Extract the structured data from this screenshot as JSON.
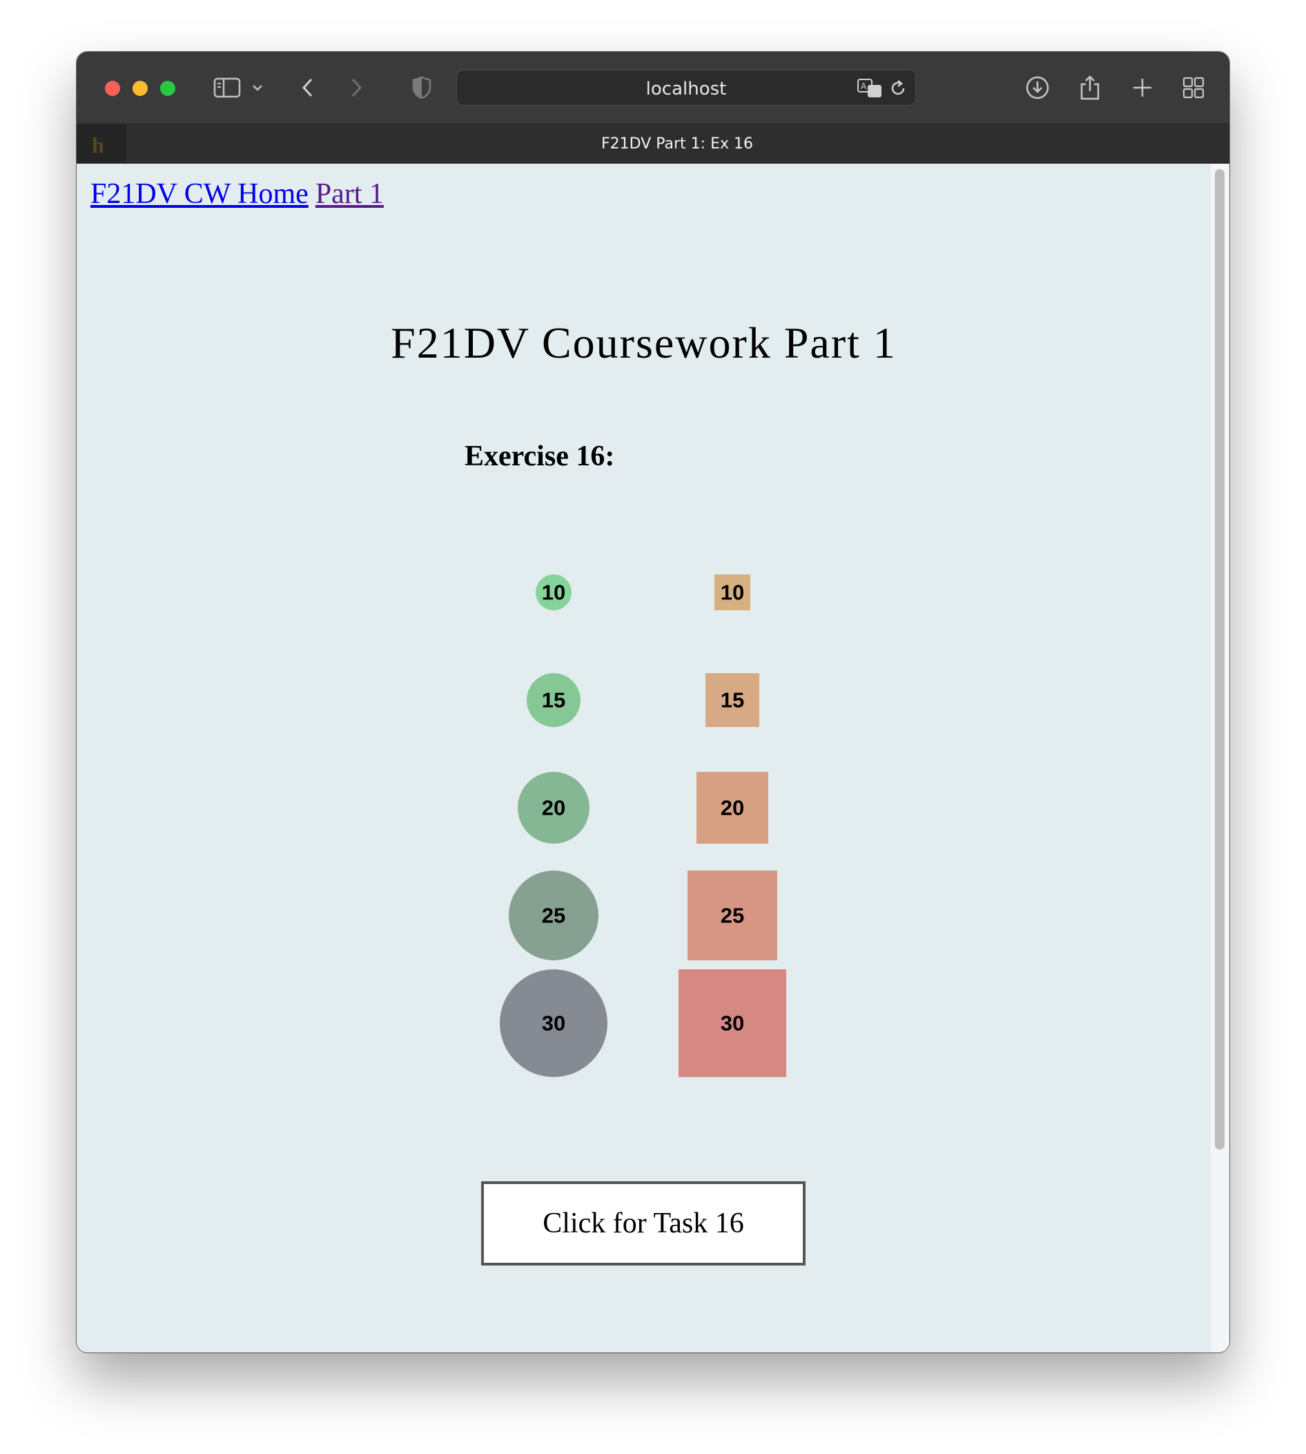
{
  "browser": {
    "address": "localhost",
    "tab_title": "F21DV Part 1: Ex 16",
    "favicon": "h"
  },
  "nav": {
    "home_link": "F21DV CW Home",
    "part_link": "Part 1"
  },
  "page": {
    "title": "F21DV Coursework Part 1",
    "subtitle": "Exercise 16:"
  },
  "chart_data": {
    "type": "scatter",
    "title": "",
    "values": [
      10,
      15,
      20,
      25,
      30
    ],
    "series": [
      {
        "shape": "circle",
        "values": [
          10,
          15,
          20,
          25,
          30
        ],
        "colors": [
          "#86d49a",
          "#85c896",
          "#86b794",
          "#86a192",
          "#868b93"
        ]
      },
      {
        "shape": "square",
        "values": [
          10,
          15,
          20,
          25,
          30
        ],
        "colors": [
          "#d6b081",
          "#d7a985",
          "#d7a083",
          "#d69683",
          "#d68983"
        ]
      }
    ],
    "labels": [
      "10",
      "15",
      "20",
      "25",
      "30"
    ]
  },
  "button": {
    "label": "Click for Task 16"
  }
}
